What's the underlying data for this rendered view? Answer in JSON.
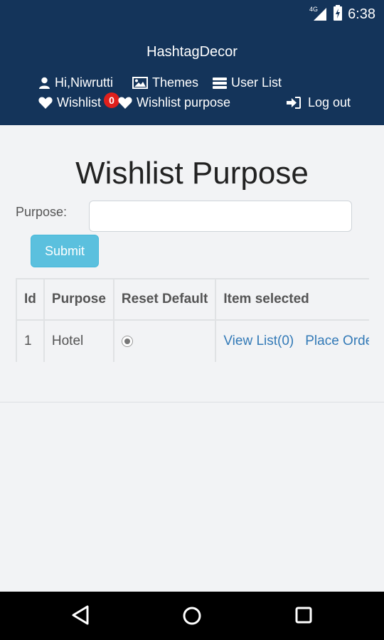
{
  "status_bar": {
    "network": "4G",
    "time": "6:38",
    "icons": [
      "signal-icon",
      "battery-icon"
    ]
  },
  "header": {
    "brand": "HashtagDecor",
    "nav": {
      "user": "Hi,Niwrutti",
      "themes": "Themes",
      "user_list": "User List",
      "wishlist": "Wishlist",
      "wishlist_badge": "0",
      "wishlist_purpose": "Wishlist purpose",
      "logout": "Log out"
    },
    "colors": {
      "background": "#14345a",
      "badge": "#e0201c"
    }
  },
  "main": {
    "title": "Wishlist Purpose",
    "form": {
      "purpose_label": "Purpose:",
      "purpose_value": "",
      "submit_label": "Submit"
    },
    "table": {
      "columns": [
        "Id",
        "Purpose",
        "Reset Default",
        "Item selected"
      ],
      "rows": [
        {
          "id": "1",
          "purpose": "Hotel",
          "reset_default": "selected",
          "view_list": "View List(0)",
          "place": "Place Order"
        }
      ]
    }
  },
  "colors": {
    "accent_button": "#5bc0de",
    "link": "#337ab7"
  }
}
